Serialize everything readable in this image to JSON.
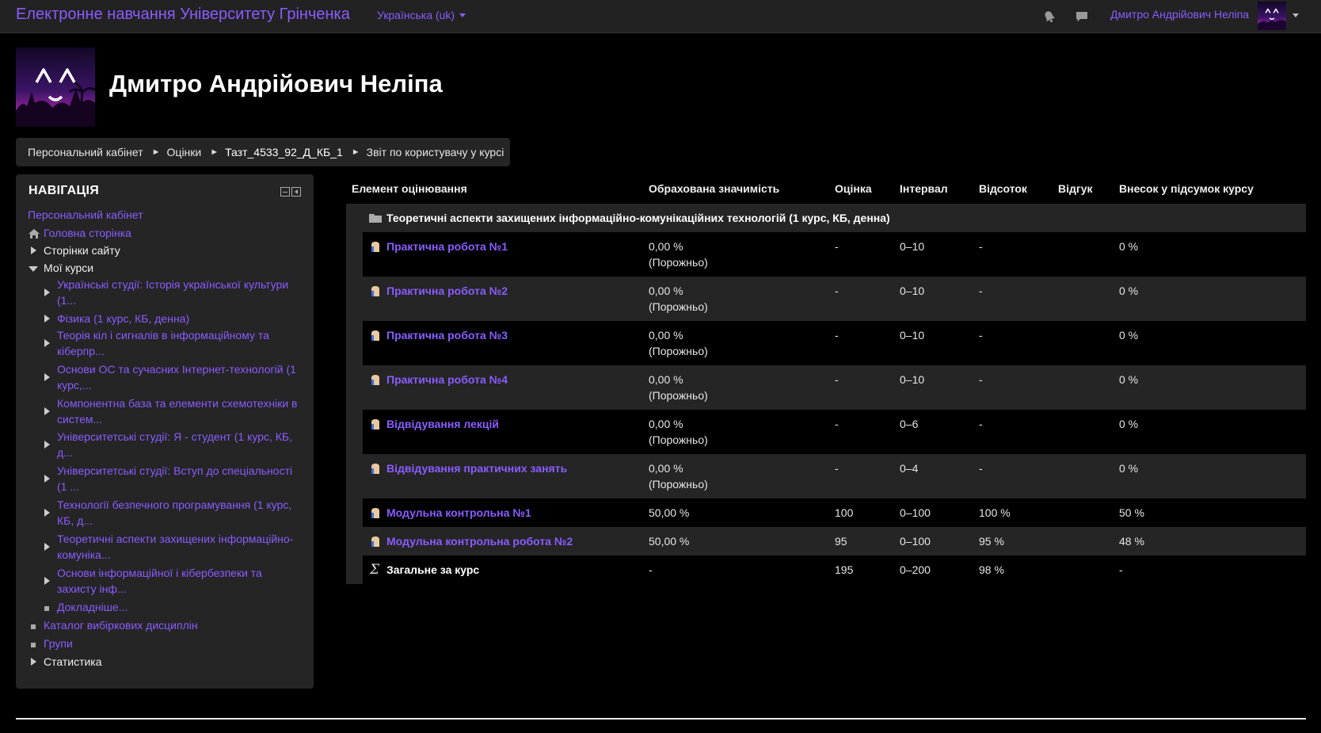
{
  "topbar": {
    "site_name": "Електронне навчання Університету Грінченка",
    "language": "Українська (uk)",
    "user_name": "Дмитро Андрійович Неліпа",
    "icons": [
      "bell-icon",
      "chat-icon"
    ]
  },
  "header": {
    "title": "Дмитро Андрійович Неліпа"
  },
  "breadcrumb": {
    "items": [
      "Персональний кабінет",
      "Оцінки",
      "Тазт_4533_92_Д_КБ_1",
      "Звіт по користувачу у курсі"
    ]
  },
  "navigation": {
    "heading": "НАВІГАЦІЯ",
    "dashboard": "Персональний кабінет",
    "home": "Головна сторінка",
    "site_pages": "Сторінки сайту",
    "my_courses": "Мої курси",
    "courses": [
      [
        "Українські студії: Історія української культури",
        "(1..."
      ],
      [
        "Фізика (1 курс, КБ, денна)"
      ],
      [
        "Теорія кіл і сигналів в інформаційному та",
        "кіберпр..."
      ],
      [
        "Основи ОС та сучасних Інтернет-технологій (1",
        "курс,..."
      ],
      [
        "Компонентна база та елементи схемотехніки в",
        "систем..."
      ],
      [
        "Університетські студії: Я - студент (1 курс, КБ,",
        "д..."
      ],
      [
        "Університетські студії: Вступ до спеціальності",
        "(1 ..."
      ],
      [
        "Технології безпечного програмування (1 курс,",
        "КБ, д..."
      ],
      [
        "Теоретичні аспекти захищених інформаційно-",
        "комуніка..."
      ],
      [
        "Основи інформаційної і кібербезпеки та",
        "захисту інф..."
      ]
    ],
    "more": "Докладніше...",
    "electives": "Каталог вибіркових дисциплін",
    "groups": "Групи",
    "statistics": "Статистика"
  },
  "grade_table": {
    "headers": [
      "Елемент оцінювання",
      "Обрахована значимість",
      "Оцінка",
      "Інтервал",
      "Відсоток",
      "Відгук",
      "Внесок у підсумок курсу"
    ],
    "category": "Теоретичні аспекти захищених інформаційно-комунікаційних технологій (1 курс, КБ, денна)",
    "items": [
      {
        "name": "Практична робота №1",
        "weight": "0,00 %",
        "weight_note": "(Порожньо)",
        "grade": "-",
        "range": "0–10",
        "percent": "-",
        "feedback": "",
        "contribution": "0 %"
      },
      {
        "name": "Практична робота №2",
        "weight": "0,00 %",
        "weight_note": "(Порожньо)",
        "grade": "-",
        "range": "0–10",
        "percent": "-",
        "feedback": "",
        "contribution": "0 %"
      },
      {
        "name": "Практична робота №3",
        "weight": "0,00 %",
        "weight_note": "(Порожньо)",
        "grade": "-",
        "range": "0–10",
        "percent": "-",
        "feedback": "",
        "contribution": "0 %"
      },
      {
        "name": "Практична робота №4",
        "weight": "0,00 %",
        "weight_note": "(Порожньо)",
        "grade": "-",
        "range": "0–10",
        "percent": "-",
        "feedback": "",
        "contribution": "0 %"
      },
      {
        "name": "Відвідування лекцій",
        "weight": "0,00 %",
        "weight_note": "(Порожньо)",
        "grade": "-",
        "range": "0–6",
        "percent": "-",
        "feedback": "",
        "contribution": "0 %"
      },
      {
        "name": "Відвідування практичних занять",
        "weight": "0,00 %",
        "weight_note": "(Порожньо)",
        "grade": "-",
        "range": "0–4",
        "percent": "-",
        "feedback": "",
        "contribution": "0 %"
      },
      {
        "name": "Модульна контрольна №1",
        "weight": "50,00 %",
        "weight_note": "",
        "grade": "100",
        "range": "0–100",
        "percent": "100 %",
        "feedback": "",
        "contribution": "50 %"
      },
      {
        "name": "Модульна контрольна робота №2",
        "weight": "50,00 %",
        "weight_note": "",
        "grade": "95",
        "range": "0–100",
        "percent": "95 %",
        "feedback": "",
        "contribution": "48 %"
      }
    ],
    "total": {
      "name": "Загальне за курс",
      "weight": "-",
      "grade": "195",
      "range": "0–200",
      "percent": "98 %",
      "feedback": "",
      "contribution": "-"
    }
  },
  "colors": {
    "accent": "#8a5cff",
    "background": "#000000",
    "panel": "#252525",
    "topbar": "#222222"
  }
}
